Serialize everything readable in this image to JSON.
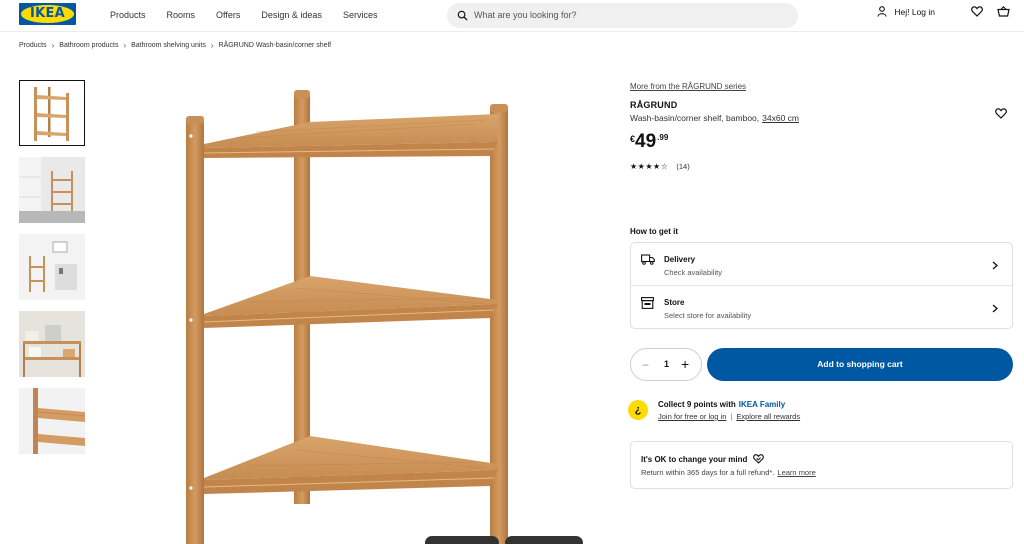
{
  "header": {
    "logo_text": "IKEA",
    "nav": [
      "Products",
      "Rooms",
      "Offers",
      "Design & ideas",
      "Services"
    ],
    "search_placeholder": "What are you looking for?",
    "login_label": "Hej! Log in"
  },
  "breadcrumb": [
    "Products",
    "Bathroom products",
    "Bathroom shelving units",
    "RÅGRUND Wash-basin/corner shelf"
  ],
  "product": {
    "series_link": "More from the RÅGRUND series",
    "name": "RÅGRUND",
    "description": "Wash-basin/corner shelf, bamboo,",
    "measurements": "34x60 cm",
    "price_currency": "€",
    "price_integer": "49",
    "price_decimal": ".99",
    "stars": "★★★★☆",
    "rating_value": 4.5,
    "review_count": "(14)"
  },
  "get_it": {
    "heading": "How to get it",
    "options": [
      {
        "title": "Delivery",
        "subtitle": "Check availability"
      },
      {
        "title": "Store",
        "subtitle": "Select store for availability"
      }
    ]
  },
  "cart": {
    "quantity": "1",
    "minus": "−",
    "plus": "+",
    "add_label": "Add to shopping cart"
  },
  "family": {
    "badge": "¿",
    "text": "Collect 9 points with",
    "brand": "IKEA Family",
    "link1": "Join for free or log in",
    "separator": "|",
    "link2": "Explore all rewards"
  },
  "returns": {
    "title": "It's OK to change your mind",
    "text": "Return within 365 days for a full refund*.",
    "link": "Learn more"
  },
  "colors": {
    "brand_blue": "#0058a3",
    "brand_yellow": "#ffdb00",
    "bamboo": "#c8915a"
  }
}
